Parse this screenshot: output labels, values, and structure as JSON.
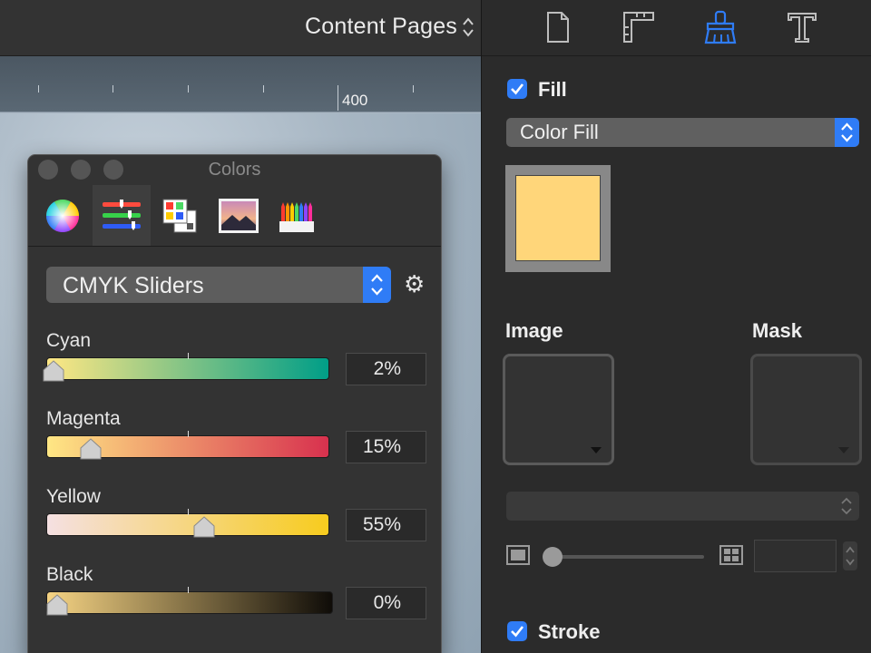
{
  "document": {
    "title": "Content Pages",
    "ruler_label": "400"
  },
  "colors_panel": {
    "title": "Colors",
    "modes": [
      {
        "name": "color-wheel-icon"
      },
      {
        "name": "color-sliders-icon",
        "active": true
      },
      {
        "name": "color-palettes-icon"
      },
      {
        "name": "image-palettes-icon"
      },
      {
        "name": "pencils-icon"
      }
    ],
    "model": "CMYK Sliders",
    "sliders": [
      {
        "label": "Cyan",
        "value": "2%",
        "fraction": 0.02,
        "gradient": [
          "#ffe784",
          "#009e87"
        ]
      },
      {
        "label": "Magenta",
        "value": "15%",
        "fraction": 0.15,
        "gradient": [
          "#ffe784",
          "#d8314e"
        ]
      },
      {
        "label": "Yellow",
        "value": "55%",
        "fraction": 0.55,
        "gradient": [
          "#f5e0e2",
          "#f7cc1e"
        ]
      },
      {
        "label": "Black",
        "value": "0%",
        "fraction": 0.0,
        "gradient": [
          "#f5d383",
          "#0f0c08"
        ]
      }
    ]
  },
  "inspector": {
    "tabs": [
      "document-icon",
      "ruler-icon",
      "style-brush-icon",
      "text-icon"
    ],
    "active_tab": "style-brush-icon",
    "fill": {
      "label": "Fill",
      "checked": true,
      "type": "Color Fill",
      "color": "#ffd67a"
    },
    "image_label": "Image",
    "mask_label": "Mask",
    "blend_mode": "",
    "scale_value": "",
    "stroke": {
      "label": "Stroke",
      "checked": true
    }
  },
  "colors": {
    "accent": "#2f7cf6",
    "panel_bg": "#333333",
    "inspector_bg": "#2b2b2b"
  }
}
